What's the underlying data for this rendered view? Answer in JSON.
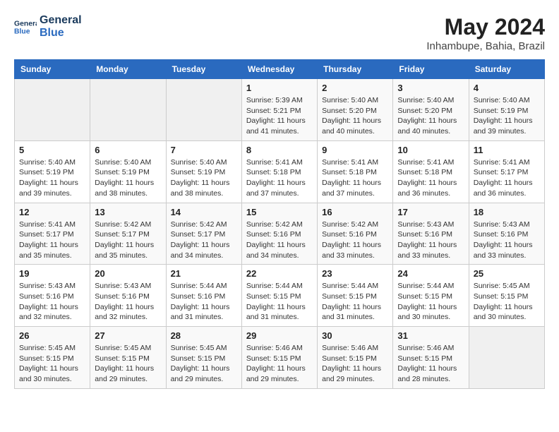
{
  "header": {
    "logo_line1": "General",
    "logo_line2": "Blue",
    "month": "May 2024",
    "location": "Inhambupe, Bahia, Brazil"
  },
  "days_of_week": [
    "Sunday",
    "Monday",
    "Tuesday",
    "Wednesday",
    "Thursday",
    "Friday",
    "Saturday"
  ],
  "weeks": [
    [
      {
        "day": "",
        "info": ""
      },
      {
        "day": "",
        "info": ""
      },
      {
        "day": "",
        "info": ""
      },
      {
        "day": "1",
        "info": "Sunrise: 5:39 AM\nSunset: 5:21 PM\nDaylight: 11 hours and 41 minutes."
      },
      {
        "day": "2",
        "info": "Sunrise: 5:40 AM\nSunset: 5:20 PM\nDaylight: 11 hours and 40 minutes."
      },
      {
        "day": "3",
        "info": "Sunrise: 5:40 AM\nSunset: 5:20 PM\nDaylight: 11 hours and 40 minutes."
      },
      {
        "day": "4",
        "info": "Sunrise: 5:40 AM\nSunset: 5:19 PM\nDaylight: 11 hours and 39 minutes."
      }
    ],
    [
      {
        "day": "5",
        "info": "Sunrise: 5:40 AM\nSunset: 5:19 PM\nDaylight: 11 hours and 39 minutes."
      },
      {
        "day": "6",
        "info": "Sunrise: 5:40 AM\nSunset: 5:19 PM\nDaylight: 11 hours and 38 minutes."
      },
      {
        "day": "7",
        "info": "Sunrise: 5:40 AM\nSunset: 5:19 PM\nDaylight: 11 hours and 38 minutes."
      },
      {
        "day": "8",
        "info": "Sunrise: 5:41 AM\nSunset: 5:18 PM\nDaylight: 11 hours and 37 minutes."
      },
      {
        "day": "9",
        "info": "Sunrise: 5:41 AM\nSunset: 5:18 PM\nDaylight: 11 hours and 37 minutes."
      },
      {
        "day": "10",
        "info": "Sunrise: 5:41 AM\nSunset: 5:18 PM\nDaylight: 11 hours and 36 minutes."
      },
      {
        "day": "11",
        "info": "Sunrise: 5:41 AM\nSunset: 5:17 PM\nDaylight: 11 hours and 36 minutes."
      }
    ],
    [
      {
        "day": "12",
        "info": "Sunrise: 5:41 AM\nSunset: 5:17 PM\nDaylight: 11 hours and 35 minutes."
      },
      {
        "day": "13",
        "info": "Sunrise: 5:42 AM\nSunset: 5:17 PM\nDaylight: 11 hours and 35 minutes."
      },
      {
        "day": "14",
        "info": "Sunrise: 5:42 AM\nSunset: 5:17 PM\nDaylight: 11 hours and 34 minutes."
      },
      {
        "day": "15",
        "info": "Sunrise: 5:42 AM\nSunset: 5:16 PM\nDaylight: 11 hours and 34 minutes."
      },
      {
        "day": "16",
        "info": "Sunrise: 5:42 AM\nSunset: 5:16 PM\nDaylight: 11 hours and 33 minutes."
      },
      {
        "day": "17",
        "info": "Sunrise: 5:43 AM\nSunset: 5:16 PM\nDaylight: 11 hours and 33 minutes."
      },
      {
        "day": "18",
        "info": "Sunrise: 5:43 AM\nSunset: 5:16 PM\nDaylight: 11 hours and 33 minutes."
      }
    ],
    [
      {
        "day": "19",
        "info": "Sunrise: 5:43 AM\nSunset: 5:16 PM\nDaylight: 11 hours and 32 minutes."
      },
      {
        "day": "20",
        "info": "Sunrise: 5:43 AM\nSunset: 5:16 PM\nDaylight: 11 hours and 32 minutes."
      },
      {
        "day": "21",
        "info": "Sunrise: 5:44 AM\nSunset: 5:16 PM\nDaylight: 11 hours and 31 minutes."
      },
      {
        "day": "22",
        "info": "Sunrise: 5:44 AM\nSunset: 5:15 PM\nDaylight: 11 hours and 31 minutes."
      },
      {
        "day": "23",
        "info": "Sunrise: 5:44 AM\nSunset: 5:15 PM\nDaylight: 11 hours and 31 minutes."
      },
      {
        "day": "24",
        "info": "Sunrise: 5:44 AM\nSunset: 5:15 PM\nDaylight: 11 hours and 30 minutes."
      },
      {
        "day": "25",
        "info": "Sunrise: 5:45 AM\nSunset: 5:15 PM\nDaylight: 11 hours and 30 minutes."
      }
    ],
    [
      {
        "day": "26",
        "info": "Sunrise: 5:45 AM\nSunset: 5:15 PM\nDaylight: 11 hours and 30 minutes."
      },
      {
        "day": "27",
        "info": "Sunrise: 5:45 AM\nSunset: 5:15 PM\nDaylight: 11 hours and 29 minutes."
      },
      {
        "day": "28",
        "info": "Sunrise: 5:45 AM\nSunset: 5:15 PM\nDaylight: 11 hours and 29 minutes."
      },
      {
        "day": "29",
        "info": "Sunrise: 5:46 AM\nSunset: 5:15 PM\nDaylight: 11 hours and 29 minutes."
      },
      {
        "day": "30",
        "info": "Sunrise: 5:46 AM\nSunset: 5:15 PM\nDaylight: 11 hours and 29 minutes."
      },
      {
        "day": "31",
        "info": "Sunrise: 5:46 AM\nSunset: 5:15 PM\nDaylight: 11 hours and 28 minutes."
      },
      {
        "day": "",
        "info": ""
      }
    ]
  ]
}
